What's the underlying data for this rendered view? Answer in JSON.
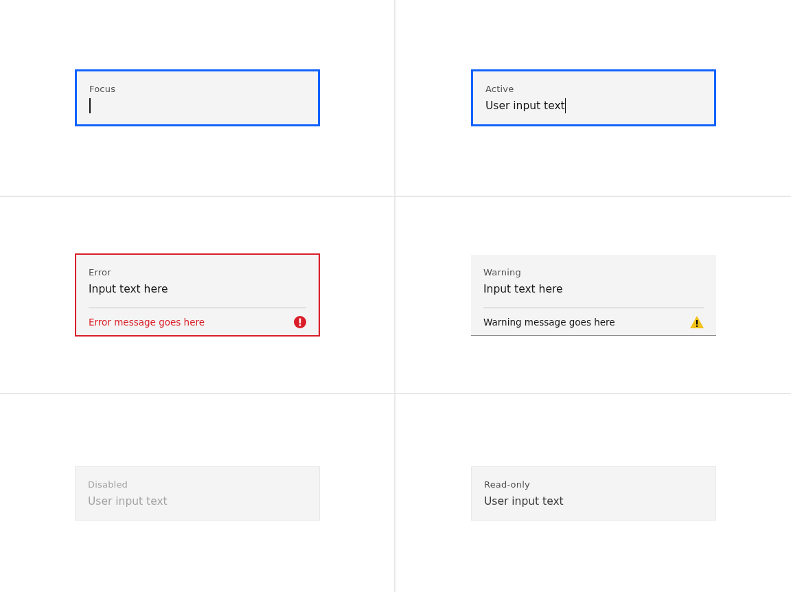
{
  "fields": [
    {
      "kind": "focus",
      "label": "Focus",
      "cursor": true
    },
    {
      "kind": "active",
      "label": "Active",
      "value": "User input text",
      "cursor": true
    },
    {
      "kind": "error",
      "label": "Error",
      "value": "Input text here",
      "message": "Error message goes here",
      "cursor": false
    },
    {
      "kind": "warning",
      "label": "Warning",
      "value": "Input text here",
      "message": "Warning message goes here",
      "cursor": false
    },
    {
      "kind": "disabled",
      "label": "Disabled",
      "value": "User input text",
      "cursor": false
    },
    {
      "kind": "readonly",
      "label": "Read-only",
      "value": "User input text",
      "cursor": false
    }
  ]
}
